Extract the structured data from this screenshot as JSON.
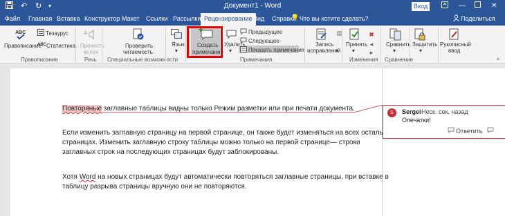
{
  "window": {
    "title": "Документ1 - Word",
    "signin": "Вход",
    "icons": [
      "save-icon",
      "undo-icon",
      "redo-icon",
      "quick-access-dropdown-icon",
      "ribbon-display-icon",
      "minimize-icon",
      "maximize-icon",
      "close-icon"
    ]
  },
  "tabs": [
    {
      "label": "Файл"
    },
    {
      "label": "Главная"
    },
    {
      "label": "Вставка"
    },
    {
      "label": "Конструктор"
    },
    {
      "label": "Макет"
    },
    {
      "label": "Ссылки"
    },
    {
      "label": "Рассылки"
    },
    {
      "label": "Рецензирование",
      "active": true
    },
    {
      "label": "Вид"
    },
    {
      "label": "Справка"
    }
  ],
  "tell_me": "Что вы хотите сделать?",
  "share": "Поделиться",
  "ribbon": {
    "spelling": "Правописание",
    "thesaurus": "Тезаурус",
    "stats": "Статистика",
    "read_aloud_1": "Прочесть",
    "read_aloud_2": "вслух",
    "check_access_1": "Проверить",
    "check_access_2": "читаемость",
    "language": "Язык",
    "new_comment_1": "Создать",
    "new_comment_2": "примечание",
    "delete": "Удалить",
    "previous": "Предыдущее",
    "next": "Следующее",
    "show_comments": "Показать примечания",
    "track_1": "Запись",
    "track_2": "исправлений",
    "accept": "Принять",
    "compare": "Сравнить",
    "protect": "Защитить",
    "ink_1": "Рукописный",
    "ink_2": "ввод",
    "groups": {
      "proofing": "Правописание",
      "speech": "Речь",
      "accessibility": "Специальные возможности",
      "comments": "Примечания",
      "changes": "Изменения",
      "compare": "Сравнение"
    }
  },
  "document": {
    "p1_sel": "Повторяные",
    "p1_rest": " заглавные таблицы видны только Режим разметки или при печати документа.",
    "p2_l1": "Если изменить заглавную страницу на первой странице, он также будет изменяться на всех остальных",
    "p2_l2": "страницах. Изменить заглавную строку таблицы можно только на первой странице— строки",
    "p2_l3": "заглавных строк на последующих страницах будут заблокированы.",
    "p3_l1a": "Хотя ",
    "p3_l1b": "Word",
    "p3_l1c": " на новых страницах будут автоматически повторяться заглавные страницы, при вставке в",
    "p3_l2": "таблицу разрыва страницы вручную они не повторяются."
  },
  "comment": {
    "avatar_letter": "S",
    "author": "Sergei",
    "time": "Неск. сек. назад",
    "text": "Опечатки!",
    "reply": "Ответить",
    "accent": "#c0303b"
  },
  "colors": {
    "titlebar": "#2b579a",
    "highlight": "#e00000"
  }
}
